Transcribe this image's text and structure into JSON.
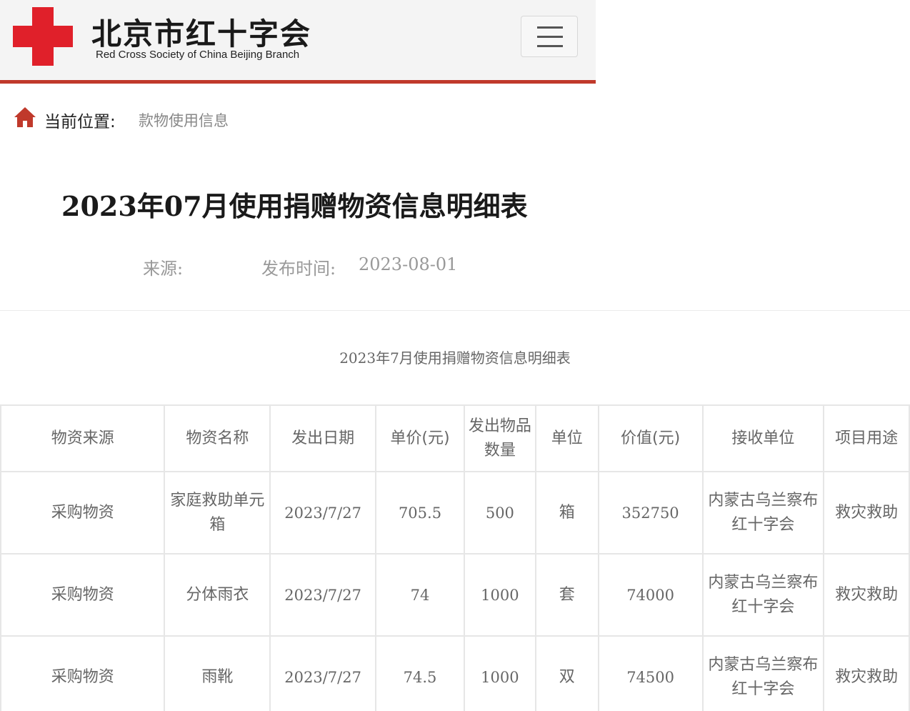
{
  "header": {
    "brand_cn": "北京市红十字会",
    "brand_en": "Red Cross Society of China Beijing Branch",
    "accent_color": "#c0392b",
    "logo_color": "#e0202a",
    "menu_icon": "hamburger-menu-icon"
  },
  "breadcrumb": {
    "icon": "home-icon",
    "label": "当前位置:",
    "current": "款物使用信息"
  },
  "article": {
    "title": "2023年07月使用捐赠物资信息明细表",
    "source_label": "来源:",
    "date_label": "发布时间:",
    "date": "2023-08-01"
  },
  "table": {
    "caption": "2023年7月使用捐赠物资信息明细表",
    "headers": [
      "物资来源",
      "物资名称",
      "发出日期",
      "单价(元)",
      "发出物品数量",
      "单位",
      "价值(元)",
      "接收单位",
      "项目用途"
    ],
    "rows": [
      [
        "采购物资",
        "家庭救助单元箱",
        "2023/7/27",
        "705.5",
        "500",
        "箱",
        "352750",
        "内蒙古乌兰察布红十字会",
        "救灾救助"
      ],
      [
        "采购物资",
        "分体雨衣",
        "2023/7/27",
        "74",
        "1000",
        "套",
        "74000",
        "内蒙古乌兰察布红十字会",
        "救灾救助"
      ],
      [
        "采购物资",
        "雨靴",
        "2023/7/27",
        "74.5",
        "1000",
        "双",
        "74500",
        "内蒙古乌兰察布红十字会",
        "救灾救助"
      ]
    ]
  }
}
